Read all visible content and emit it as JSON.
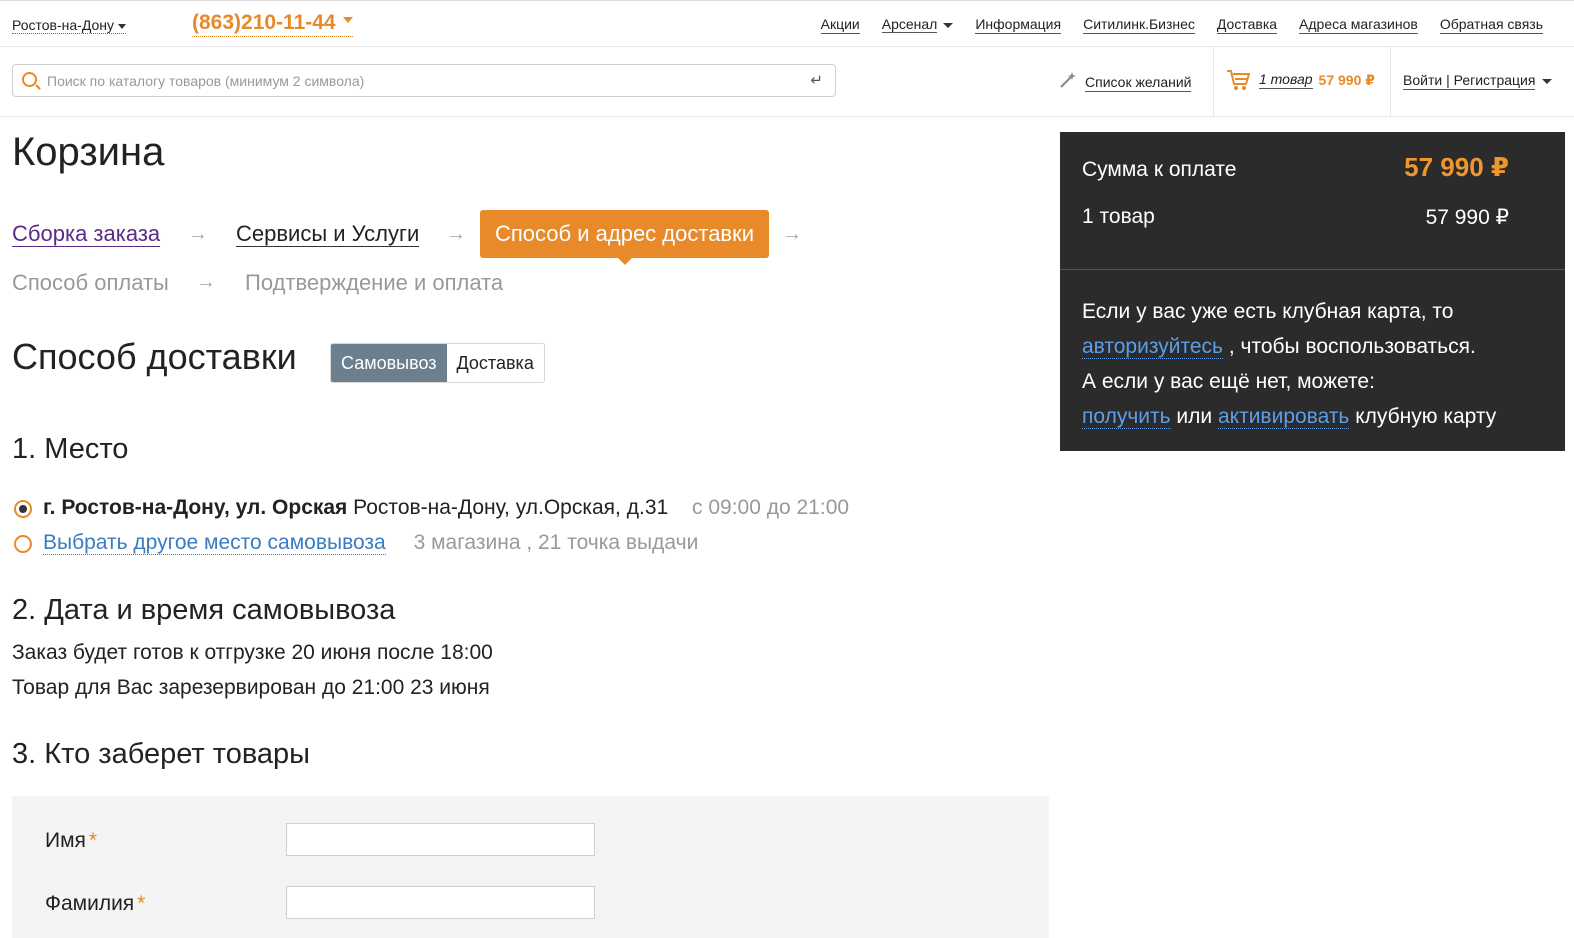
{
  "header": {
    "city": "Ростов-на-Дону",
    "phone": "(863)210-11-44",
    "nav": [
      "Акции",
      "Арсенал",
      "Информация",
      "Ситилинк.Бизнес",
      "Доставка",
      "Адреса магазинов",
      "Обратная связь"
    ]
  },
  "search": {
    "placeholder": "Поиск по каталогу товаров (минимум 2 символа)",
    "enter_icon": "↵"
  },
  "wishlist": {
    "label": "Список желаний"
  },
  "cart": {
    "count": "1 товар",
    "sum": "57 990 ₽"
  },
  "login": {
    "label": "Войти | Регистрация"
  },
  "page": {
    "title": "Корзина"
  },
  "steps": {
    "s1": "Сборка заказа",
    "s2": "Сервисы и Услуги",
    "s3": "Способ и адрес доставки",
    "s4": "Способ оплаты",
    "s5": "Подтверждение и оплата",
    "arrow": "→"
  },
  "delivery": {
    "title": "Способ доставки",
    "pickup": "Самовывоз",
    "courier": "Доставка"
  },
  "place": {
    "title": "1. Место",
    "selected_bold": "г. Ростов-на-Дону, ул. Орская",
    "selected_addr": "Ростов-на-Дону, ул.Орская, д.31",
    "selected_hours": "с 09:00 до 21:00",
    "other_link": "Выбрать другое место самовывоза",
    "other_info": "3 магазина , 21 точка выдачи"
  },
  "datetime": {
    "title": "2. Дата и время самовывоза",
    "line1": "Заказ будет готов к отгрузке 20 июня после 18:00",
    "line2": "Товар для Вас зарезервирован до 21:00 23 июня"
  },
  "who": {
    "title": "3. Кто заберет товары",
    "first_name_label": "Имя",
    "last_name_label": "Фамилия",
    "required_mark": "*"
  },
  "summary": {
    "pay_label": "Сумма к оплате",
    "pay_total": "57 990 ₽",
    "items_label": "1 товар",
    "items_total": "57 990 ₽",
    "club_t1": "Если у вас уже есть клубная карта, то",
    "club_link_auth": "авторизуйтесь",
    "club_t2": ", чтобы воспользоваться.",
    "club_t3": "А если у вас ещё нет, можете:",
    "club_link_get": "получить",
    "club_or": "или",
    "club_link_activate": "активировать",
    "club_t4": "клубную карту"
  },
  "colors": {
    "accent": "#e88a2a",
    "link": "#3a7cc2",
    "sidebar": "#2b2b2b",
    "toggle_on": "#6b7f8f"
  }
}
